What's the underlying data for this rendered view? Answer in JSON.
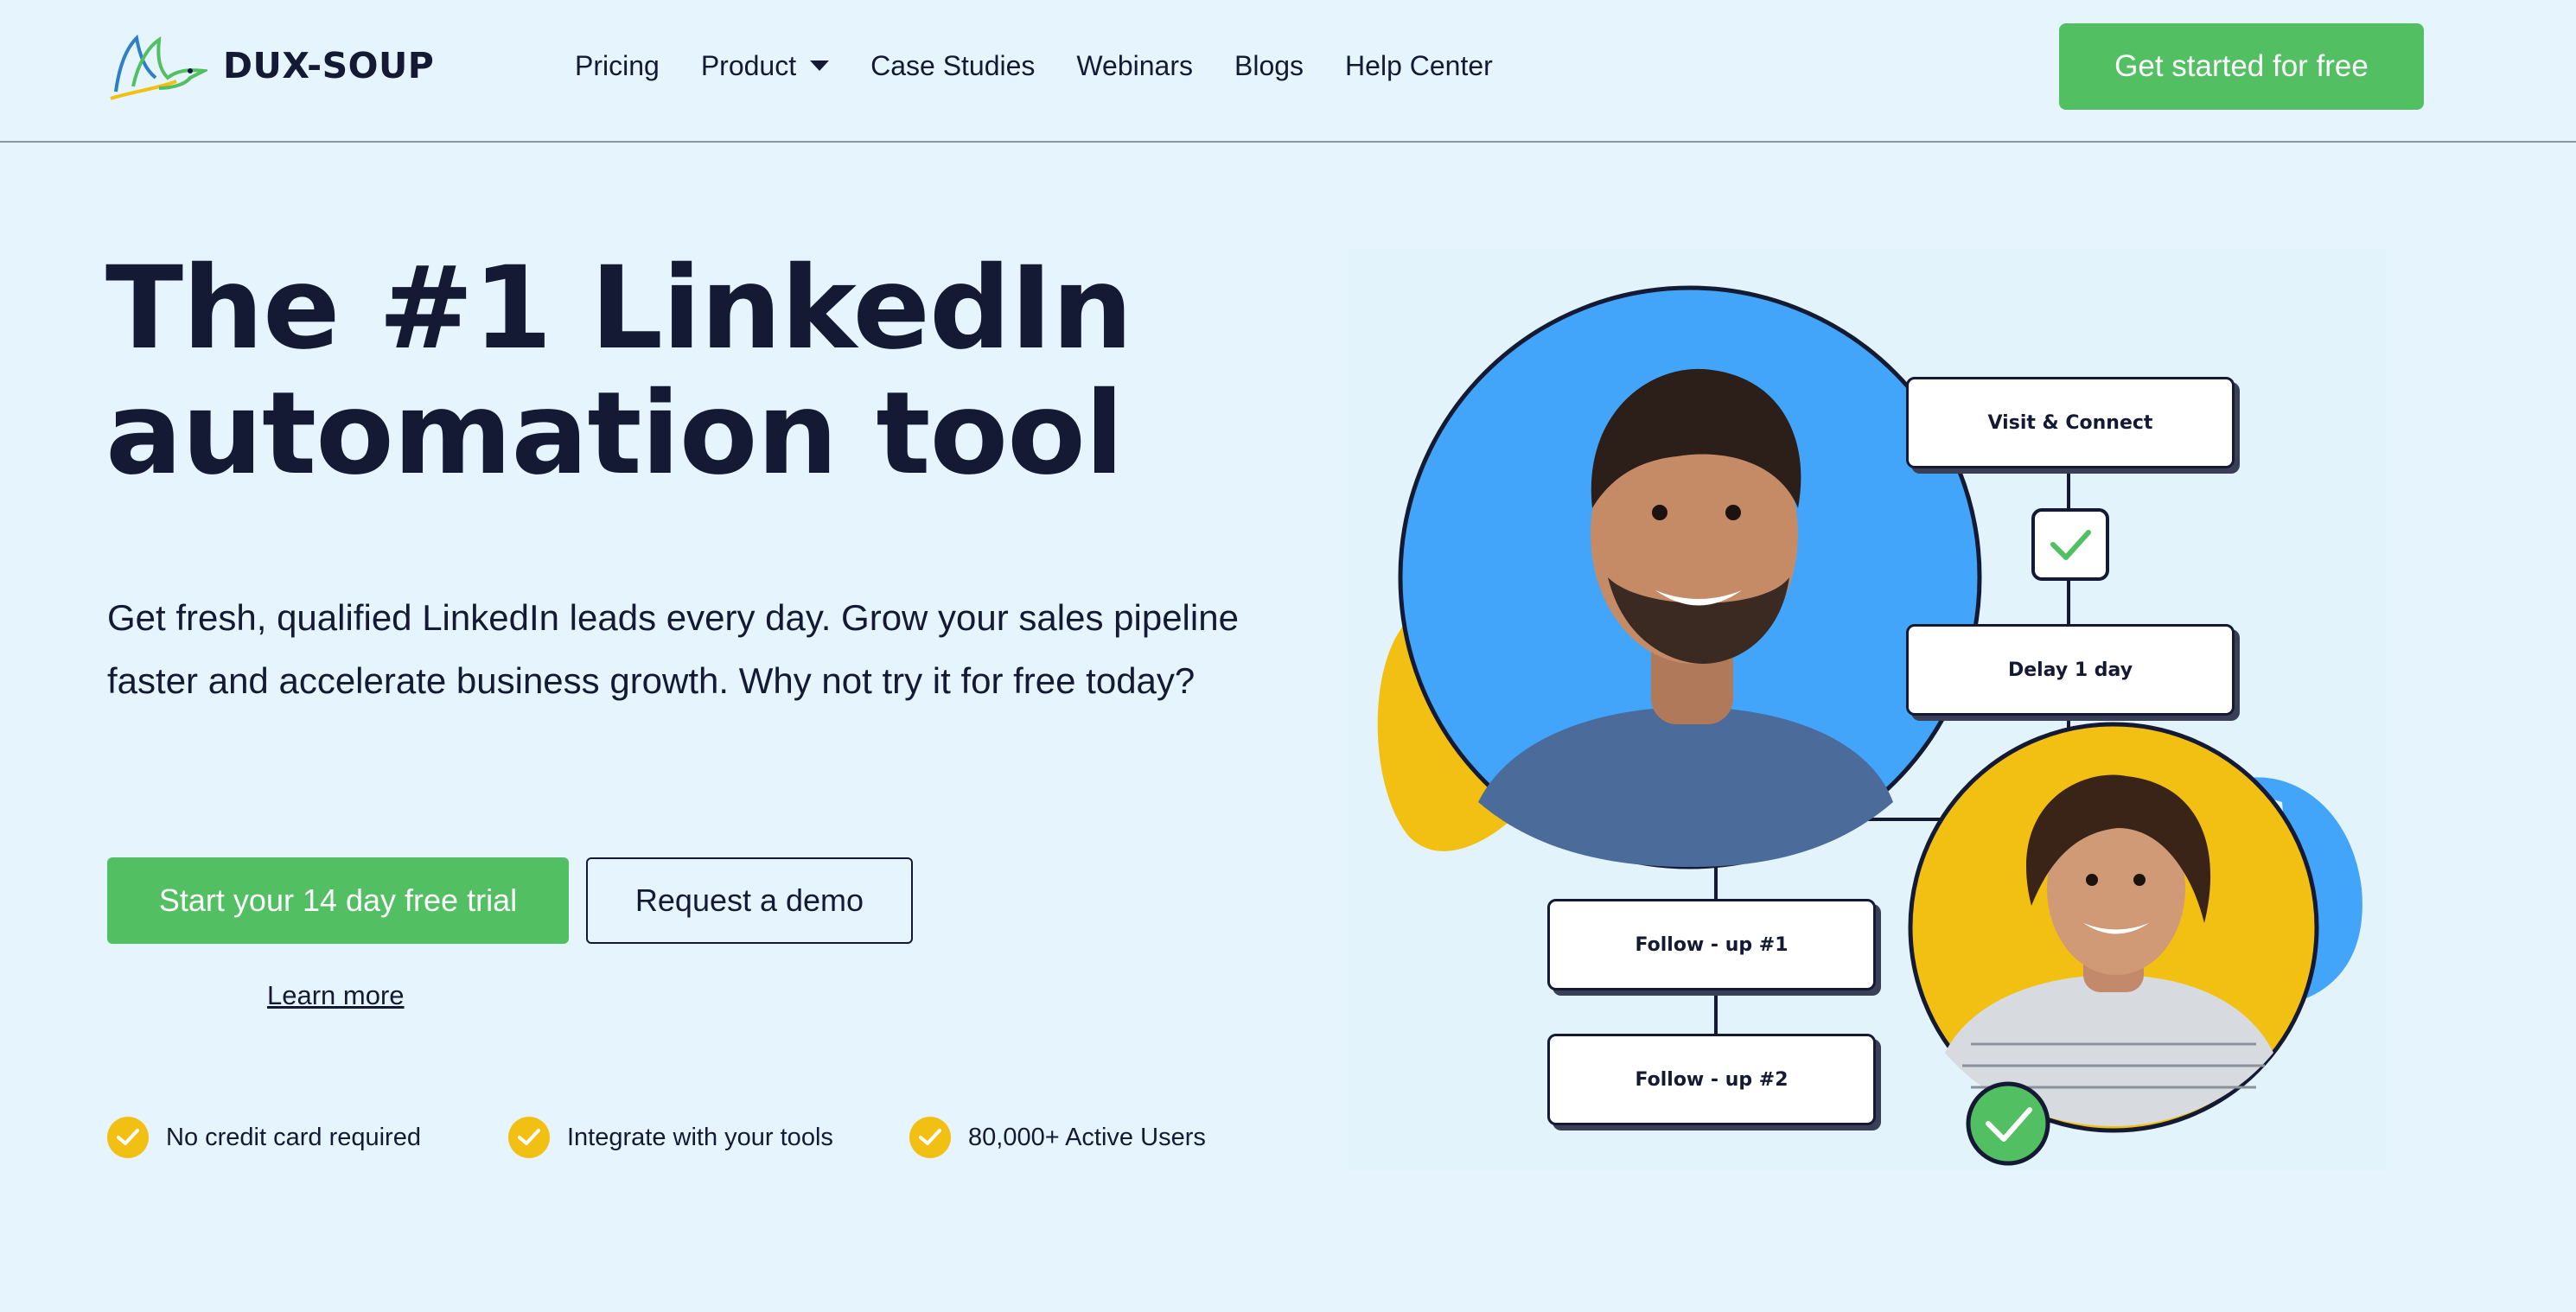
{
  "brand": {
    "name": "DUX-SOUP",
    "logo_icon": "duck-logo-icon"
  },
  "nav": {
    "items": [
      {
        "label": "Pricing"
      },
      {
        "label": "Product",
        "has_dropdown": true
      },
      {
        "label": "Case Studies"
      },
      {
        "label": "Webinars"
      },
      {
        "label": "Blogs"
      },
      {
        "label": "Help Center"
      }
    ],
    "cta_label": "Get started for free"
  },
  "hero": {
    "title_line1": "The #1 LinkedIn",
    "title_line2": "automation tool",
    "subtitle": "Get fresh, qualified LinkedIn leads every day. Grow your sales pipeline faster and accelerate business growth. Why not try it for free today?",
    "primary_button": "Start your 14 day free trial",
    "secondary_button": "Request a demo",
    "learn_more": "Learn more",
    "features": [
      "No credit card required",
      "Integrate with your tools",
      "80,000+ Active Users"
    ]
  },
  "illustration": {
    "flow_steps": {
      "visit_connect": "Visit & Connect",
      "delay": "Delay 1 day",
      "follow_up_1": "Follow - up #1",
      "follow_up_2": "Follow - up #2"
    }
  },
  "colors": {
    "background": "#e6f5fd",
    "accent_green": "#52bf62",
    "accent_yellow": "#f2c012",
    "accent_blue": "#42a5fa",
    "text_dark": "#141a33"
  }
}
